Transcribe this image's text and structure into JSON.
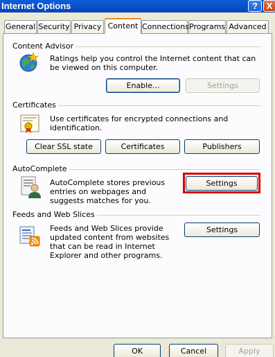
{
  "window": {
    "title": "Internet Options",
    "help_label": "?",
    "close_label": "X"
  },
  "tabs": [
    {
      "label": "General"
    },
    {
      "label": "Security"
    },
    {
      "label": "Privacy"
    },
    {
      "label": "Content",
      "active": true
    },
    {
      "label": "Connections"
    },
    {
      "label": "Programs"
    },
    {
      "label": "Advanced"
    }
  ],
  "content_advisor": {
    "heading": "Content Advisor",
    "description": "Ratings help you control the Internet content that can be viewed on this computer.",
    "enable_label": "Enable...",
    "settings_label": "Settings",
    "icon": "globe-ratings-icon"
  },
  "certificates": {
    "heading": "Certificates",
    "description": "Use certificates for encrypted connections and identification.",
    "clear_ssl_label": "Clear SSL state",
    "certificates_label": "Certificates",
    "publishers_label": "Publishers",
    "icon": "certificate-icon"
  },
  "autocomplete": {
    "heading": "AutoComplete",
    "description": "AutoComplete stores previous entries on webpages and suggests matches for you.",
    "settings_label": "Settings",
    "icon": "autocomplete-person-icon",
    "highlight_color": "#d80000"
  },
  "feeds": {
    "heading": "Feeds and Web Slices",
    "description": "Feeds and Web Slices provide updated content from websites that can be read in Internet Explorer and other programs.",
    "settings_label": "Settings",
    "icon": "feed-document-icon"
  },
  "footer": {
    "ok_label": "OK",
    "cancel_label": "Cancel",
    "apply_label": "Apply"
  }
}
